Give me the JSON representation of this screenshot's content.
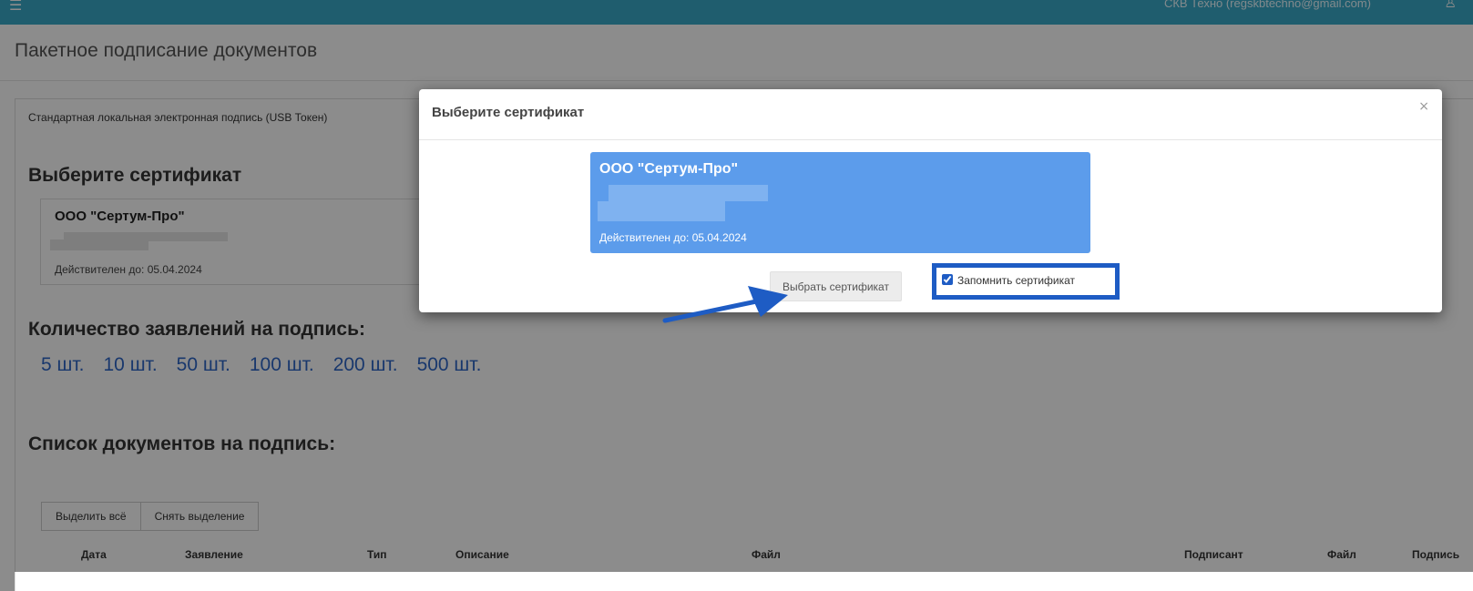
{
  "topbar": {
    "menu_icon": "☰",
    "user_text": "СКВ Техно (regskbtechno@gmail.com)",
    "user_icon": "♙"
  },
  "page": {
    "title": "Пакетное подписание документов",
    "signature_type": "Стандартная локальная электронная подпись (USB Токен)",
    "choose_cert_heading": "Выберите сертификат",
    "cert": {
      "name": "ООО \"Сертум-Про\"",
      "valid_until": "Действителен до: 05.04.2024"
    },
    "qty_heading": "Количество заявлений на подпись:",
    "qty_options": [
      "5 шт.",
      "10 шт.",
      "50 шт.",
      "100 шт.",
      "200 шт.",
      "500 шт."
    ],
    "doc_list_heading": "Список документов на подпись:",
    "select_all_label": "Выделить всё",
    "deselect_label": "Снять выделение",
    "table_headers": [
      "Дата",
      "Заявление",
      "Тип",
      "Описание",
      "Файл",
      "Подписант",
      "Файл",
      "Подпись"
    ]
  },
  "modal": {
    "title": "Выберите сертификат",
    "close_icon": "×",
    "cert": {
      "name": "ООО \"Сертум-Про\"",
      "valid_until": "Действителен до: 05.04.2024"
    },
    "choose_button": "Выбрать сертификат",
    "remember_label": "Запомнить сертификат",
    "remember_checked": true
  },
  "colors": {
    "topbar": "#3aa9c8",
    "link": "#2f67c6",
    "selected_cert": "#5c9ceb",
    "highlight": "#1e5cc4"
  }
}
